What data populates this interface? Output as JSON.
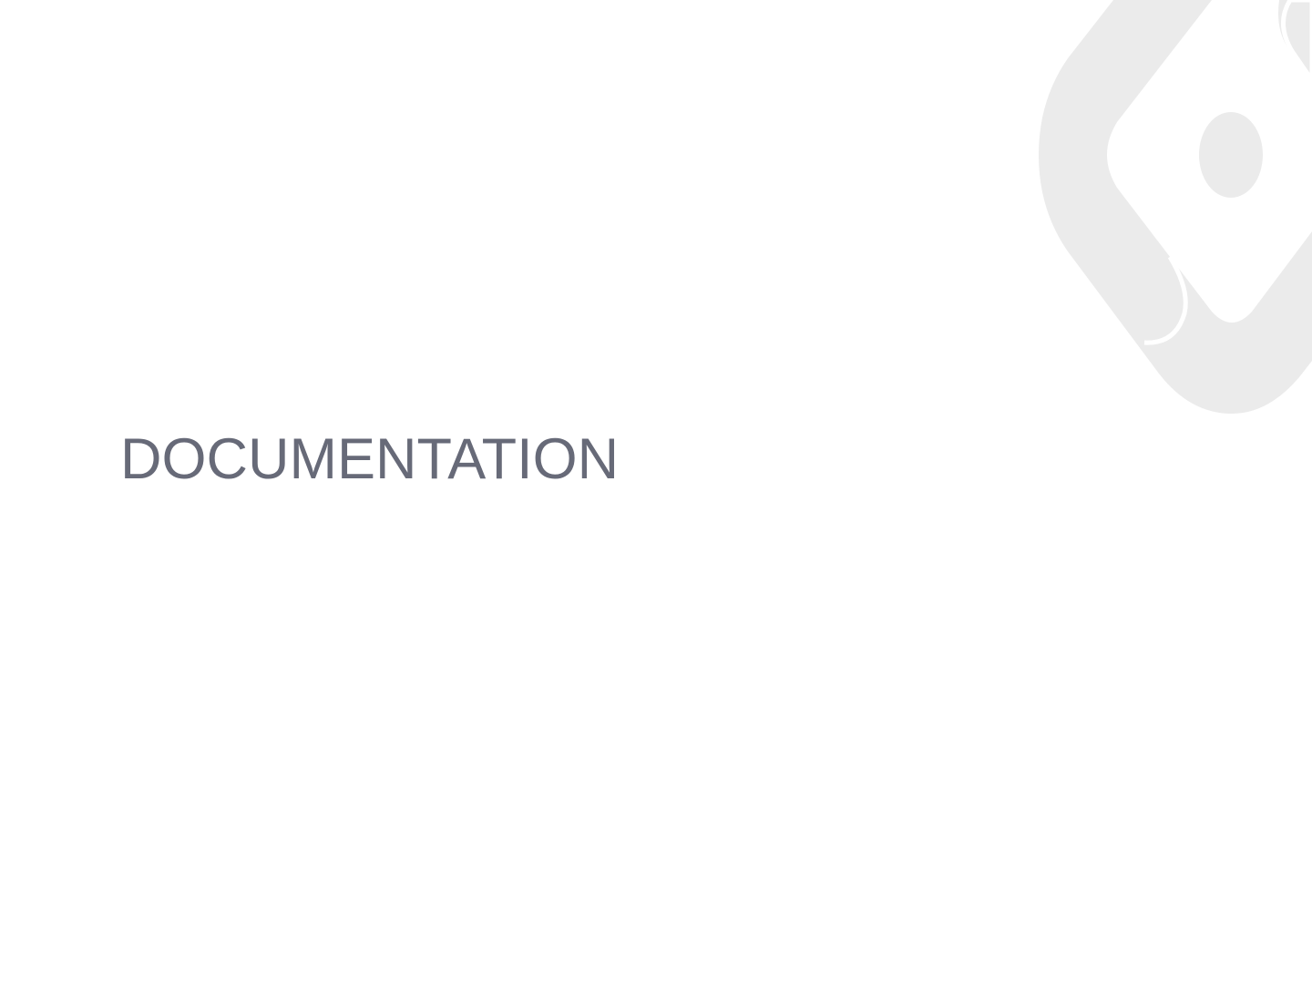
{
  "slide": {
    "title": "DOCUMENTATION"
  },
  "colors": {
    "background": "#ffffff",
    "title_text": "#676a78",
    "watermark": "#ebebeb"
  },
  "icons": {
    "watermark": "diamond-logo-icon"
  }
}
